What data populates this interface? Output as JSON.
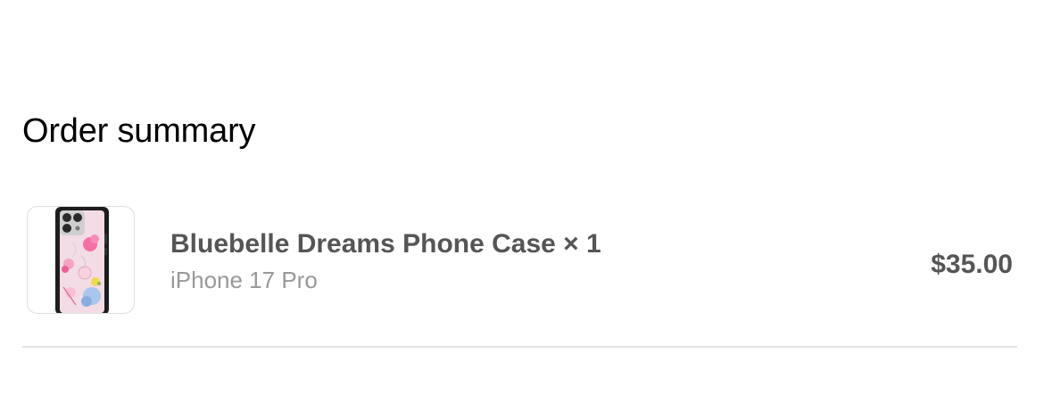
{
  "order_summary": {
    "title": "Order summary",
    "items": [
      {
        "name": "Bluebelle Dreams Phone Case × 1",
        "variant": "iPhone 17 Pro",
        "price": "$35.00",
        "thumbnail_icon": "floral-phone-case-image"
      }
    ]
  },
  "colors": {
    "title_text": "#000000",
    "item_text": "#555555",
    "variant_text": "#999999",
    "divider": "#e4e4e4",
    "thumb_border": "#dedede"
  }
}
